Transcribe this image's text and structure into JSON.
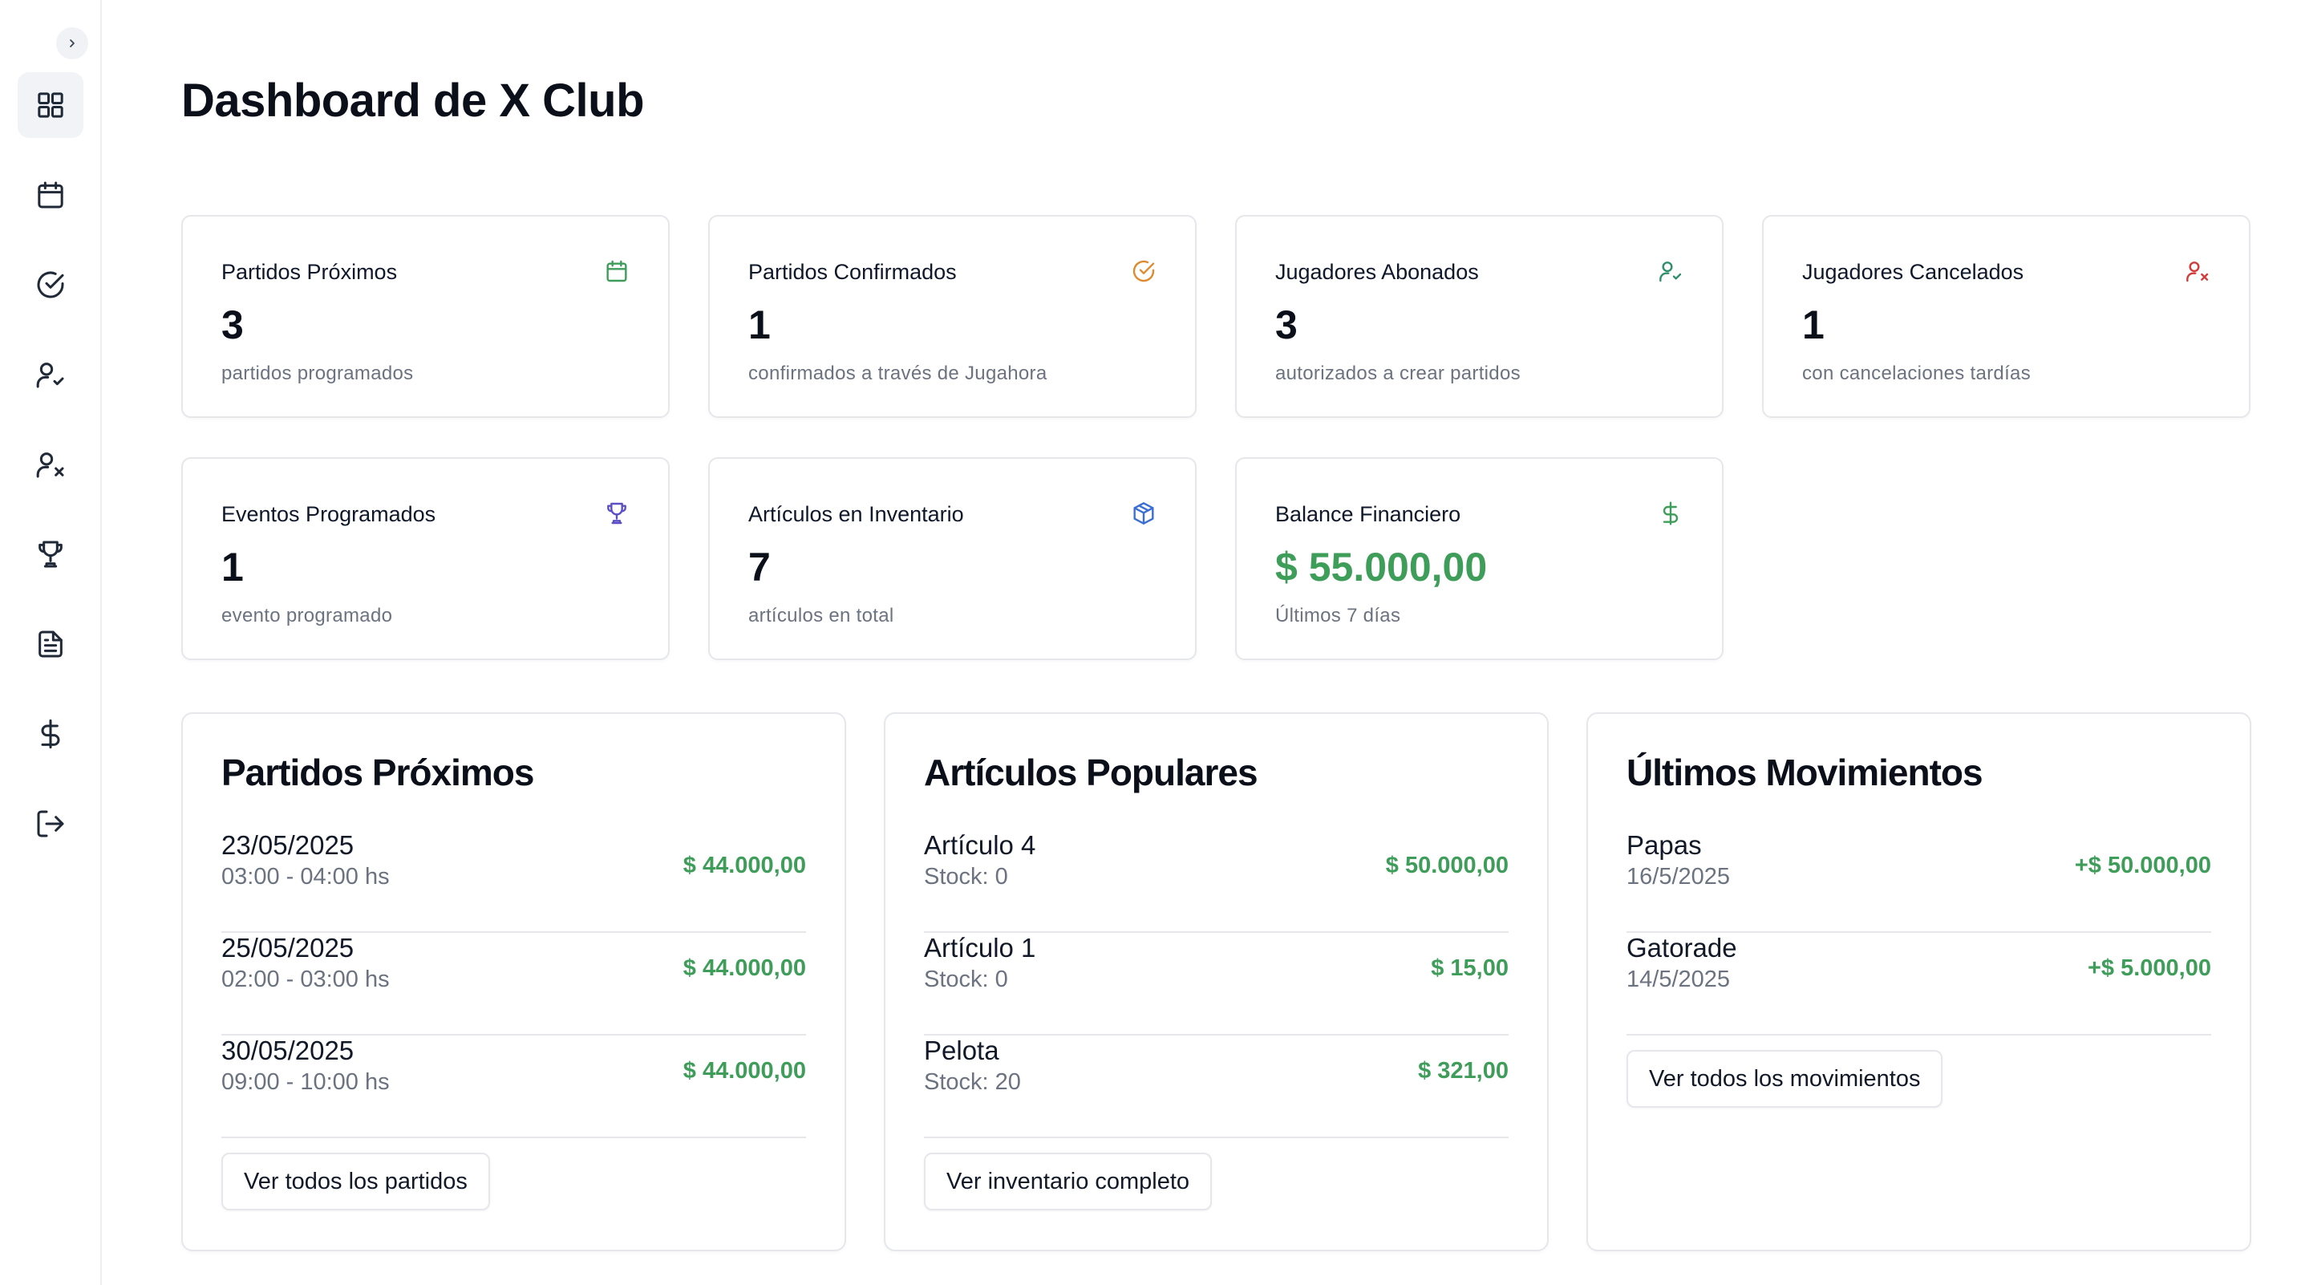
{
  "app": {
    "title": "Dashboard de X Club"
  },
  "sidebar": {
    "items": [
      {
        "name": "dashboard",
        "icon": "grid-icon",
        "active": true
      },
      {
        "name": "calendar",
        "icon": "calendar-icon"
      },
      {
        "name": "confirmed",
        "icon": "check-circle-icon"
      },
      {
        "name": "players-subscribed",
        "icon": "user-check-icon"
      },
      {
        "name": "players-cancelled",
        "icon": "user-x-icon"
      },
      {
        "name": "events",
        "icon": "trophy-icon"
      },
      {
        "name": "reports",
        "icon": "file-text-icon"
      },
      {
        "name": "finances",
        "icon": "dollar-icon"
      },
      {
        "name": "logout",
        "icon": "logout-icon"
      }
    ]
  },
  "stats": [
    {
      "title": "Partidos Próximos",
      "value": "3",
      "sub": "partidos programados",
      "icon": "calendar-icon",
      "color": "#3f9d5a"
    },
    {
      "title": "Partidos Confirmados",
      "value": "1",
      "sub": "confirmados a través de Jugahora",
      "icon": "check-circle-icon",
      "color": "#e08a2e"
    },
    {
      "title": "Jugadores Abonados",
      "value": "3",
      "sub": "autorizados a crear partidos",
      "icon": "user-check-icon",
      "color": "#2f8f6a"
    },
    {
      "title": "Jugadores Cancelados",
      "value": "1",
      "sub": "con cancelaciones tardías",
      "icon": "user-x-icon",
      "color": "#d33b3b"
    },
    {
      "title": "Eventos Programados",
      "value": "1",
      "sub": "evento programado",
      "icon": "trophy-icon",
      "color": "#5b4fc4"
    },
    {
      "title": "Artículos en Inventario",
      "value": "7",
      "sub": "artículos en total",
      "icon": "package-icon",
      "color": "#3b6fd6"
    },
    {
      "title": "Balance Financiero",
      "value": "$ 55.000,00",
      "sub": "Últimos 7 días",
      "icon": "dollar-icon",
      "color": "#3f9d5a"
    }
  ],
  "upcoming": {
    "title": "Partidos Próximos",
    "rows": [
      {
        "main": "23/05/2025",
        "sub": "03:00 - 04:00 hs",
        "amount": "$ 44.000,00"
      },
      {
        "main": "25/05/2025",
        "sub": "02:00 - 03:00 hs",
        "amount": "$ 44.000,00"
      },
      {
        "main": "30/05/2025",
        "sub": "09:00 - 10:00 hs",
        "amount": "$ 44.000,00"
      }
    ],
    "button": "Ver todos los partidos"
  },
  "popular": {
    "title": "Artículos Populares",
    "rows": [
      {
        "main": "Artículo 4",
        "sub": "Stock: 0",
        "amount": "$ 50.000,00"
      },
      {
        "main": "Artículo 1",
        "sub": "Stock: 0",
        "amount": "$ 15,00"
      },
      {
        "main": "Pelota",
        "sub": "Stock: 20",
        "amount": "$ 321,00"
      }
    ],
    "button": "Ver inventario completo"
  },
  "movements": {
    "title": "Últimos Movimientos",
    "rows": [
      {
        "main": "Papas",
        "sub": "16/5/2025",
        "amount": "+$ 50.000,00"
      },
      {
        "main": "Gatorade",
        "sub": "14/5/2025",
        "amount": "+$ 5.000,00"
      }
    ],
    "button": "Ver todos los movimientos"
  }
}
